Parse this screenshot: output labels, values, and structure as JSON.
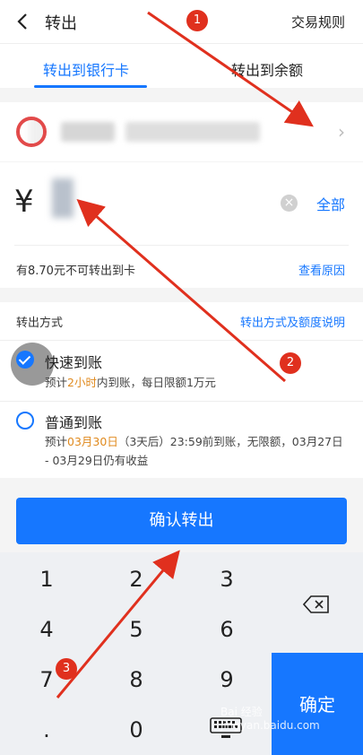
{
  "header": {
    "title": "转出",
    "rule_link": "交易规则"
  },
  "tabs": [
    {
      "label": "转出到银行卡"
    },
    {
      "label": "转出到余额"
    }
  ],
  "amount": {
    "currency_symbol": "¥",
    "value": "1",
    "all_button": "全部",
    "note": "有8.70元不可转出到卡",
    "reason_link": "查看原因"
  },
  "transfer_method": {
    "label": "转出方式",
    "help_link": "转出方式及额度说明",
    "options": [
      {
        "title": "快速到账",
        "desc_prefix": "预计",
        "desc_highlight": "2小时",
        "desc_suffix": "内到账，每日限额1万元",
        "selected": true
      },
      {
        "title": "普通到账",
        "desc_prefix": "预计",
        "desc_highlight": "03月30日",
        "desc_suffix": "（3天后）23:59前到账，无限额，03月27日 - 03月29日仍有收益",
        "selected": false
      }
    ]
  },
  "confirm_button": "确认转出",
  "keypad": {
    "keys": [
      "1",
      "2",
      "3",
      "4",
      "5",
      "6",
      "7",
      "8",
      "9",
      ".",
      "0"
    ],
    "ok_label": "确定",
    "delete_icon": "backspace-icon",
    "keyboard_icon": "keyboard-icon"
  },
  "annotations": [
    "1",
    "2",
    "3"
  ],
  "watermark": "Bai 经验 jingyan.baidu.com",
  "colors": {
    "accent": "#1677ff",
    "highlight": "#e08a1e",
    "annotation": "#e0301e"
  }
}
